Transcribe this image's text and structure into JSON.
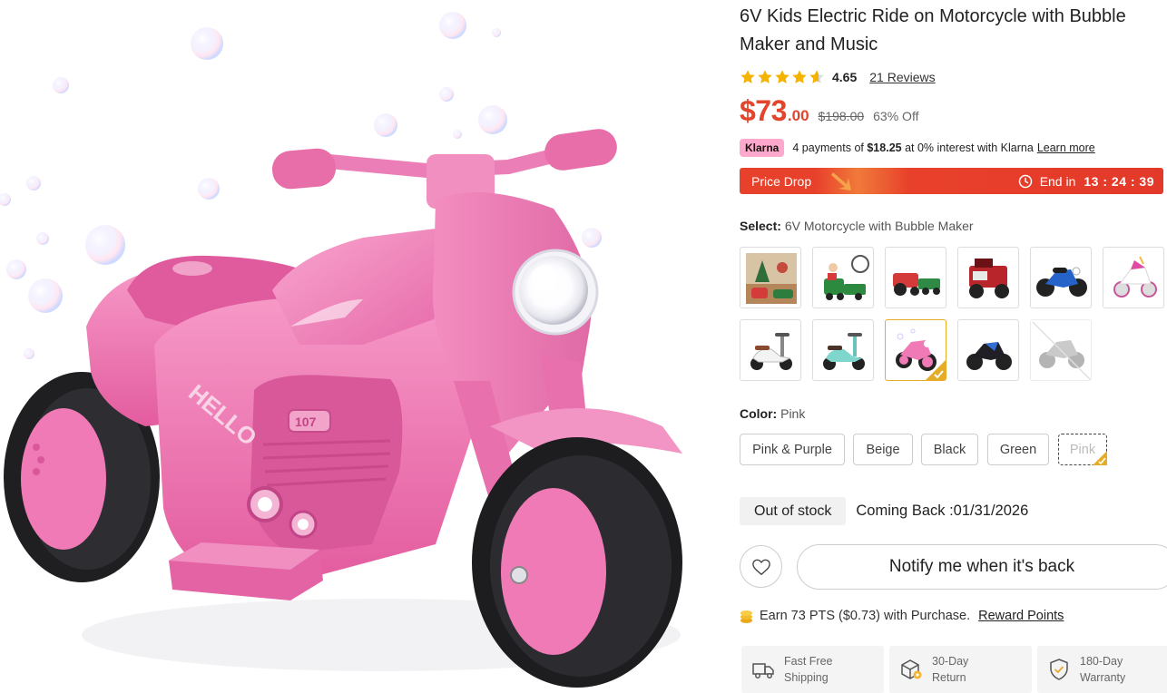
{
  "product": {
    "title": "6V Kids Electric Ride on Motorcycle with Bubble Maker and Music",
    "rating": "4.65",
    "rating_stars": 4.65,
    "reviews_link": "21 Reviews",
    "price_dollars": "$73",
    "price_cents": ".00",
    "price_original": "$198.00",
    "discount": "63% Off"
  },
  "klarna": {
    "badge": "Klarna",
    "text_before": "4 payments of",
    "amount": "$18.25",
    "text_after": "at 0% interest with Klarna",
    "link": "Learn more"
  },
  "price_drop": {
    "label": "Price Drop",
    "end_label": "End in",
    "timer": "13 : 24 : 39",
    "colors": {
      "bar": "#e8412b",
      "accent": "#f07a3a"
    }
  },
  "select": {
    "label": "Select:",
    "value": "6V Motorcycle with Bubble Maker",
    "thumbnails": [
      {
        "name": "holiday-set",
        "icon": "scene-thumb"
      },
      {
        "name": "train",
        "icon": "train-thumb"
      },
      {
        "name": "tractor-red",
        "icon": "tractor-thumb"
      },
      {
        "name": "tractor-trailer",
        "icon": "tractor-thumb"
      },
      {
        "name": "motorcycle-blue",
        "icon": "motorcycle-thumb"
      },
      {
        "name": "unicorn-bike",
        "icon": "motorcycle-thumb"
      },
      {
        "name": "scooter-white",
        "icon": "scooter-thumb"
      },
      {
        "name": "scooter-mint",
        "icon": "scooter-thumb"
      },
      {
        "name": "motorcycle-pink",
        "icon": "motorcycle-thumb",
        "selected": true
      },
      {
        "name": "motorcycle-black-blue",
        "icon": "motorcycle-thumb"
      },
      {
        "name": "motorcycle-gray",
        "icon": "motorcycle-thumb",
        "unavailable": true
      }
    ]
  },
  "color": {
    "label": "Color:",
    "value": "Pink",
    "options": [
      "Pink & Purple",
      "Beige",
      "Black",
      "Green",
      "Pink"
    ],
    "selected_index": 4
  },
  "stock": {
    "status": "Out of stock",
    "coming_back": "Coming Back :01/31/2026"
  },
  "actions": {
    "favorite_icon": "heart-icon",
    "notify_label": "Notify me when it's back"
  },
  "points": {
    "text": "Earn 73 PTS ($0.73) with Purchase.",
    "link": "Reward Points"
  },
  "perks": [
    {
      "icon": "truck-icon",
      "line1": "Fast Free",
      "line2": "Shipping"
    },
    {
      "icon": "box-return-icon",
      "line1": "30-Day",
      "line2": "Return"
    },
    {
      "icon": "shield-check-icon",
      "line1": "180-Day",
      "line2": "Warranty"
    }
  ],
  "colors": {
    "price": "#e2452c",
    "star": "#f5b301",
    "product_pink": "#f07ab6",
    "selected_border": "#e5ac28"
  }
}
